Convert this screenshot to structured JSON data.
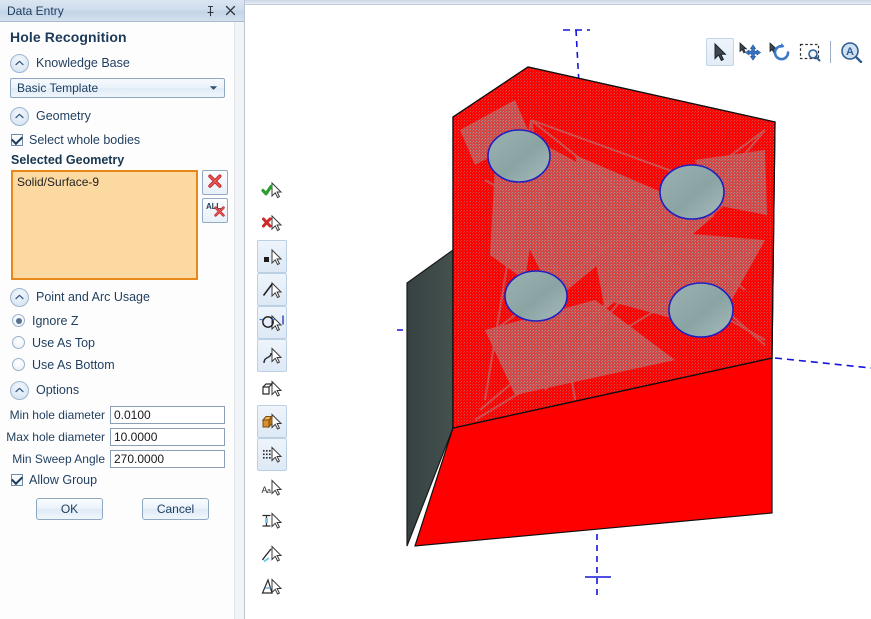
{
  "dock": {
    "title": "Data Entry",
    "pin_icon": "pin-icon",
    "close_icon": "close-icon",
    "heading": "Hole Recognition",
    "sections": {
      "knowledge_base": {
        "label": "Knowledge Base",
        "template_value": "Basic Template",
        "template_options": [
          "Basic Template"
        ]
      },
      "geometry": {
        "label": "Geometry",
        "select_whole_bodies_label": "Select whole bodies",
        "select_whole_bodies_checked": true,
        "selected_geometry_label": "Selected Geometry",
        "selected_items": [
          "Solid/Surface-9"
        ],
        "delete_button_icon": "delete-x-icon",
        "delete_all_button_icon": "delete-all-icon",
        "delete_all_text": "ALL"
      },
      "point_arc_usage": {
        "label": "Point and Arc Usage",
        "options": [
          {
            "label": "Ignore Z",
            "selected": true
          },
          {
            "label": "Use As Top",
            "selected": false
          },
          {
            "label": "Use As Bottom",
            "selected": false
          }
        ]
      },
      "options": {
        "label": "Options",
        "fields": [
          {
            "label": "Min hole diameter",
            "value": "0.0100"
          },
          {
            "label": "Max hole diameter",
            "value": "10.0000"
          },
          {
            "label": "Min Sweep Angle",
            "value": "270.0000"
          }
        ],
        "allow_group_label": "Allow Group",
        "allow_group_checked": true
      }
    },
    "buttons": {
      "ok": "OK",
      "cancel": "Cancel"
    }
  },
  "viewport": {
    "view_toolbar": [
      {
        "name": "select-tool",
        "icon": "arrow-cursor-icon",
        "active": true
      },
      {
        "name": "pan-tool",
        "icon": "pan-move-icon",
        "active": false
      },
      {
        "name": "rotate-tool",
        "icon": "rotate-icon",
        "active": false
      },
      {
        "name": "zoom-box-tool",
        "icon": "zoom-box-icon",
        "active": false
      },
      {
        "name": "fit-all-tool",
        "icon": "fit-magnifier-icon",
        "active": false
      }
    ],
    "tool_strip": [
      {
        "name": "pick-accept-tool",
        "icon": "cursor-green-check-icon",
        "active": false
      },
      {
        "name": "pick-reject-tool",
        "icon": "cursor-red-x-icon",
        "active": false
      },
      {
        "name": "select-point-tool",
        "icon": "cursor-point-icon",
        "active": true
      },
      {
        "name": "select-line-tool",
        "icon": "cursor-line-icon",
        "active": true
      },
      {
        "name": "select-arc-tool",
        "icon": "cursor-arc-icon",
        "active": true
      },
      {
        "name": "select-curve-tool",
        "icon": "cursor-curve-icon",
        "active": true
      },
      {
        "name": "select-surface-tool",
        "icon": "cursor-surface-icon",
        "active": false
      },
      {
        "name": "select-solid-tool",
        "icon": "cursor-solid-icon",
        "active": true
      },
      {
        "name": "select-mesh-tool",
        "icon": "cursor-mesh-icon",
        "active": true
      },
      {
        "name": "select-text-tool",
        "icon": "cursor-text-icon",
        "active": false
      },
      {
        "name": "select-dimension-tool",
        "icon": "cursor-dimension-icon",
        "active": false
      },
      {
        "name": "select-vector-tool",
        "icon": "cursor-vector-icon",
        "active": false
      },
      {
        "name": "select-plane-tool",
        "icon": "cursor-plane-icon",
        "active": false
      }
    ],
    "model": {
      "description": "3D box solid with four circular holes on top face",
      "top_face_color": "#ff0000",
      "front_face_color": "#ff0000",
      "side_face_color": "#3d4a4a",
      "hole_fill_color": "#8fa9a9",
      "hole_edge_color": "#2020c0",
      "axis_line_color": "#1515dd",
      "hole_count": 4
    }
  }
}
